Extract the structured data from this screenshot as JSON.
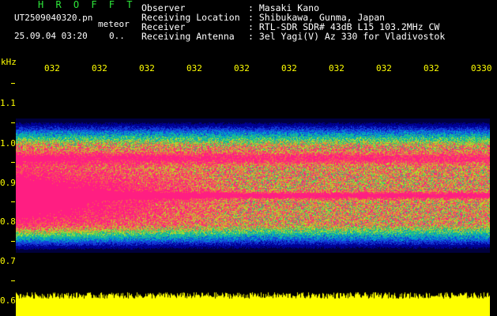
{
  "brand": "H R O F F T",
  "file": {
    "name": "UT2509040320.pn",
    "mode": "meteor",
    "datetime": "25.09.04 03:20",
    "counter": "0.."
  },
  "info": {
    "rows": [
      {
        "label": "Observer",
        "value": ": Masaki Kano"
      },
      {
        "label": "Receiving Location",
        "value": ": Shibukawa, Gunma, Japan"
      },
      {
        "label": "Receiver",
        "value": ": RTL-SDR SDR# 43dB L15 103.2MHz CW"
      },
      {
        "label": "Receiving Antenna",
        "value": ": 3el Yagi(V) Az 330 for Vladivostok"
      }
    ]
  },
  "axis": {
    "unit": "kHz",
    "time_ticks": [
      "032",
      "032",
      "032",
      "032",
      "032",
      "032",
      "032",
      "032",
      "032",
      "0330"
    ],
    "freq_ticks": [
      "1.1",
      "1.0",
      "0.9",
      "0.8",
      "0.7",
      "0.6"
    ]
  },
  "colors": {
    "text": "#ffffff",
    "brand": "#2ee83a",
    "axis": "#ffff00",
    "background": "#000000",
    "echo": "#ff1f7a"
  }
}
